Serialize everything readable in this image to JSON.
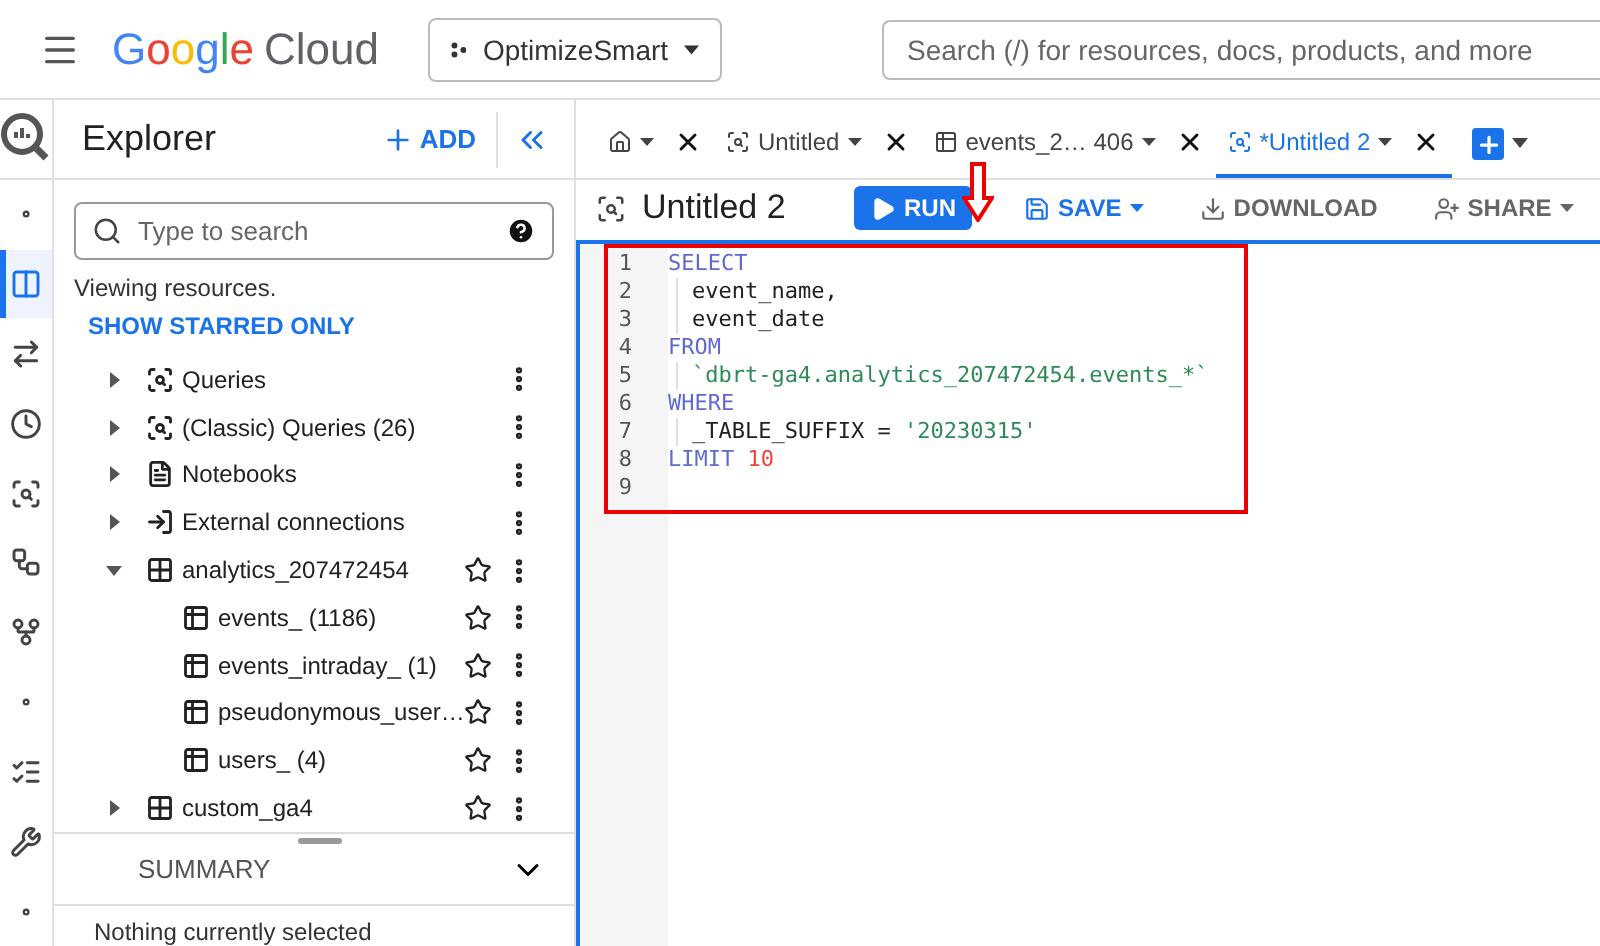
{
  "topbar": {
    "logo": [
      "Google",
      "Cloud"
    ],
    "project": "OptimizeSmart",
    "search": {
      "placeholder": "Search (/) for resources, docs, products, and more"
    }
  },
  "rail": [
    {
      "kind": "dot",
      "selected": false
    },
    {
      "kind": "panel",
      "selected": true
    },
    {
      "kind": "transfer",
      "selected": false
    },
    {
      "kind": "clock",
      "selected": false
    },
    {
      "kind": "analytics",
      "selected": false
    },
    {
      "kind": "pipeline",
      "selected": false
    },
    {
      "kind": "nodes",
      "selected": false
    },
    {
      "kind": "dot",
      "selected": false
    },
    {
      "kind": "list",
      "selected": false
    },
    {
      "kind": "wrench",
      "selected": false
    },
    {
      "kind": "dot",
      "selected": false
    }
  ],
  "explorer": {
    "title": "Explorer",
    "add": "ADD",
    "search": {
      "placeholder": "Type to search"
    },
    "info": "Viewing resources.",
    "starred_link": "SHOW STARRED ONLY",
    "tree": [
      {
        "kind": "query",
        "label": "Queries",
        "expanded": false
      },
      {
        "kind": "query",
        "label": "(Classic) Queries (26)",
        "expanded": false
      },
      {
        "kind": "notebook",
        "label": "Notebooks",
        "expanded": false
      },
      {
        "kind": "connection",
        "label": "External connections",
        "expanded": false
      },
      {
        "kind": "dataset",
        "label": "analytics_207472454",
        "expanded": true,
        "children": [
          {
            "kind": "table",
            "label": "events_ (1186)"
          },
          {
            "kind": "table",
            "label": "events_intraday_ (1)"
          },
          {
            "kind": "table",
            "label": "pseudonymous_user…"
          },
          {
            "kind": "table",
            "label": "users_ (4)"
          }
        ]
      },
      {
        "kind": "dataset",
        "label": "custom_ga4",
        "expanded": false
      }
    ],
    "summary": {
      "title": "SUMMARY",
      "expanded": false,
      "text": "Nothing currently selected"
    }
  },
  "tabs": [
    {
      "kind": "home",
      "selected": false
    },
    {
      "kind": "query",
      "label": "Untitled",
      "selected": false
    },
    {
      "kind": "table",
      "label": "events_2… 406",
      "selected": false
    },
    {
      "kind": "query",
      "label": "*Untitled 2",
      "selected": true
    }
  ],
  "editor": {
    "title": "Untitled 2",
    "actions": [
      {
        "kind": "run",
        "label": "RUN"
      },
      {
        "kind": "save",
        "label": "SAVE"
      },
      {
        "kind": "download",
        "label": "DOWNLOAD"
      },
      {
        "kind": "share",
        "label": "SHARE"
      }
    ],
    "lines": [
      {
        "number": "1",
        "indented": false,
        "tokens": [
          {
            "kind": "keyword",
            "text": "SELECT"
          }
        ]
      },
      {
        "number": "2",
        "indented": true,
        "tokens": [
          {
            "kind": "plain",
            "text": "event_name,"
          }
        ]
      },
      {
        "number": "3",
        "indented": true,
        "tokens": [
          {
            "kind": "plain",
            "text": "event_date"
          }
        ]
      },
      {
        "number": "4",
        "indented": false,
        "tokens": [
          {
            "kind": "keyword",
            "text": "FROM"
          }
        ]
      },
      {
        "number": "5",
        "indented": true,
        "tokens": [
          {
            "kind": "string",
            "text": "`dbrt-ga4.analytics_207472454.events_*`"
          }
        ]
      },
      {
        "number": "6",
        "indented": false,
        "tokens": [
          {
            "kind": "keyword",
            "text": "WHERE"
          }
        ]
      },
      {
        "number": "7",
        "indented": true,
        "tokens": [
          {
            "kind": "plain",
            "text": "_TABLE_SUFFIX = "
          },
          {
            "kind": "string",
            "text": "'20230315'"
          }
        ]
      },
      {
        "number": "8",
        "indented": false,
        "tokens": [
          {
            "kind": "keyword",
            "text": "LIMIT "
          },
          {
            "kind": "number",
            "text": "10"
          }
        ]
      },
      {
        "number": "9"
      }
    ]
  }
}
